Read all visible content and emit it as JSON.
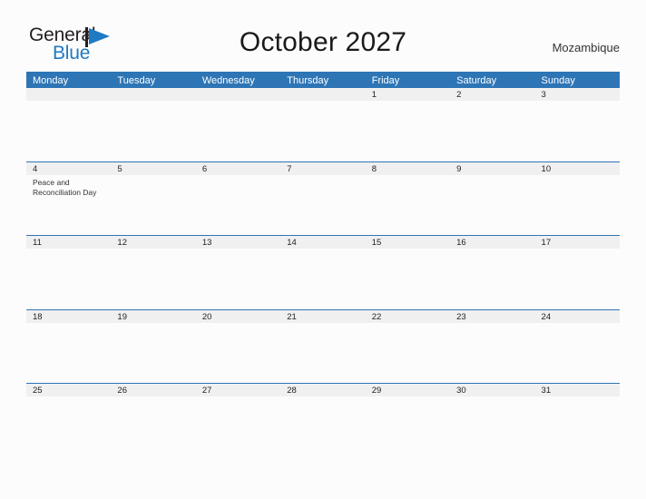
{
  "brand": {
    "name_part1": "General",
    "name_part2": "Blue",
    "mark_icon": "blue-flag-triangle-icon",
    "color_dark": "#231f20",
    "color_blue": "#1f7ac4"
  },
  "header": {
    "title": "October 2027",
    "country": "Mozambique"
  },
  "theme": {
    "header_blue": "#2e75b6",
    "date_band_gray": "#f0f0f0",
    "page_background": "#fcfcfc",
    "text_color": "#222222"
  },
  "calendar": {
    "weekdays": [
      "Monday",
      "Tuesday",
      "Wednesday",
      "Thursday",
      "Friday",
      "Saturday",
      "Sunday"
    ],
    "weeks": [
      [
        {
          "day": "",
          "events": []
        },
        {
          "day": "",
          "events": []
        },
        {
          "day": "",
          "events": []
        },
        {
          "day": "",
          "events": []
        },
        {
          "day": "1",
          "events": []
        },
        {
          "day": "2",
          "events": []
        },
        {
          "day": "3",
          "events": []
        }
      ],
      [
        {
          "day": "4",
          "events": [
            "Peace and Reconciliation Day"
          ]
        },
        {
          "day": "5",
          "events": []
        },
        {
          "day": "6",
          "events": []
        },
        {
          "day": "7",
          "events": []
        },
        {
          "day": "8",
          "events": []
        },
        {
          "day": "9",
          "events": []
        },
        {
          "day": "10",
          "events": []
        }
      ],
      [
        {
          "day": "11",
          "events": []
        },
        {
          "day": "12",
          "events": []
        },
        {
          "day": "13",
          "events": []
        },
        {
          "day": "14",
          "events": []
        },
        {
          "day": "15",
          "events": []
        },
        {
          "day": "16",
          "events": []
        },
        {
          "day": "17",
          "events": []
        }
      ],
      [
        {
          "day": "18",
          "events": []
        },
        {
          "day": "19",
          "events": []
        },
        {
          "day": "20",
          "events": []
        },
        {
          "day": "21",
          "events": []
        },
        {
          "day": "22",
          "events": []
        },
        {
          "day": "23",
          "events": []
        },
        {
          "day": "24",
          "events": []
        }
      ],
      [
        {
          "day": "25",
          "events": []
        },
        {
          "day": "26",
          "events": []
        },
        {
          "day": "27",
          "events": []
        },
        {
          "day": "28",
          "events": []
        },
        {
          "day": "29",
          "events": []
        },
        {
          "day": "30",
          "events": []
        },
        {
          "day": "31",
          "events": []
        }
      ]
    ]
  }
}
